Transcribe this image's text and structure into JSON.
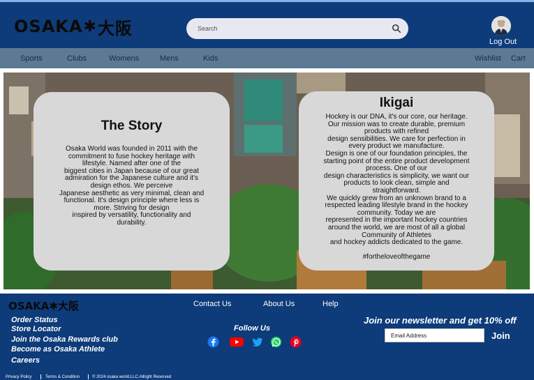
{
  "header": {
    "logo_text": "OSAKA",
    "logo_kanji": "大阪",
    "search_placeholder": "Search",
    "logout_label": "Log Out"
  },
  "nav": {
    "items": [
      "Sports",
      "Clubs",
      "Womens",
      "Mens",
      "Kids"
    ],
    "wishlist_label": "Wishlist",
    "cart_label": "Cart"
  },
  "hero": {
    "story": {
      "title": "The Story",
      "lines": [
        "Osaka World was founded in 2011 with the",
        "commitment to fuse hockey heritage with",
        "lifestyle. Named after one of the",
        "biggest cities in Japan because of our great",
        "admiration for the Japanese culture and it's",
        "design ethos. We perceive",
        "Japanese aesthetic as very minimal, clean and",
        "functional. It's design principle where less is",
        "more. Striving for design",
        "inspired by versatility, functionality and",
        "durability."
      ]
    },
    "ikigai": {
      "title": "Ikigai",
      "lines": [
        "Hockey is our DNA, it's our core, our heritage.",
        "Our mission was to create durable, premium",
        "products with refined",
        "design sensibilities. We care for perfection in",
        "every product we manufacture.",
        "Design is one of our foundation principles, the",
        "starting point of the entire product development",
        "process. One of our",
        "design characteristics is simplicity, we want our",
        "products to look clean, simple and",
        "straightforward.",
        "We quickly grew from an unknown brand to a",
        "respected leading lifestyle brand in the hockey",
        "community. Today we are",
        "represented in the important hockey countries",
        "around the world, we are most of all a global",
        "Community of Athletes",
        "and hockey addicts dedicated to the game."
      ],
      "hashtag": "#fortheloveofthegame"
    }
  },
  "footer": {
    "logo_text": "OSAKA",
    "logo_kanji": "大阪",
    "links": [
      "Contact Us",
      "About Us",
      "Help"
    ],
    "left_links": [
      "Order Status",
      "Store Locator",
      "Join the Osaka Rewards club",
      "Become as Osaka Athlete",
      "Careers"
    ],
    "follow_label": "Follow Us",
    "newsletter_title": "Join our newsletter and get 10% off",
    "email_placeholder": "Email Address",
    "join_label": "Join",
    "legal": [
      "Privacy Policy",
      "Terms & Condition",
      "© 2024 osaka world.LLC.Allright Reserved"
    ]
  },
  "colors": {
    "header_bg": "#0e3b7a",
    "nav_bg": "#5d7a95",
    "card_bg": "#d8d8d8",
    "youtube": "#ff0000",
    "facebook": "#1877f2",
    "twitter": "#1da1f2",
    "whatsapp": "#25d366",
    "pinterest": "#e60023"
  }
}
